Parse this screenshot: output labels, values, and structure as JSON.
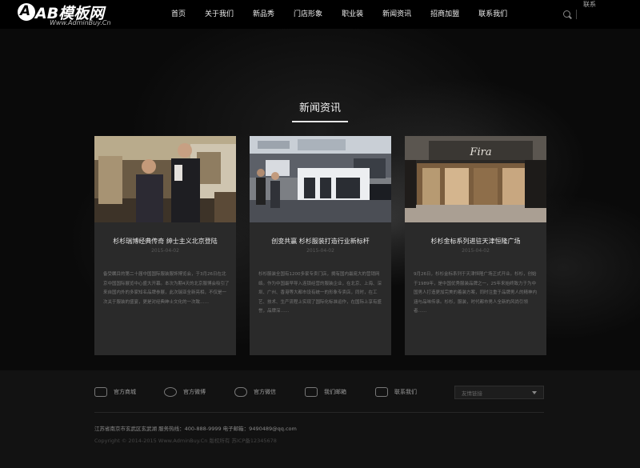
{
  "header": {
    "logo_text": "AB模板网",
    "logo_sub": "Www.AdminBuy.Cn",
    "nav": [
      "首页",
      "关于我们",
      "新品秀",
      "门店形象",
      "职业装",
      "新闻资讯",
      "招商加盟",
      "联系我们"
    ],
    "lang": "联系"
  },
  "section": {
    "title": "新闻资讯"
  },
  "cards": [
    {
      "title": "杉杉瑞博经典传奇 绅士主义北京登陆",
      "date": "2015-04-02",
      "body": "备受瞩目的第二十届中国国际服装服饰博览会，于3月26日在北京中国国际展览中心盛大开幕。本次为期4天的北京服博会吸引了来自国内外的多家知名品牌参展，此次瑞亚全新亮相，不仅是一次关于服装的盛宴，更是对经典绅士文化的一次致……"
    },
    {
      "title": "创变共赢 杉杉服装打造行业新标杆",
      "date": "2015-04-02",
      "body": "杉杉服装全国有1200多家专卖门店，拥有国内最庞大的营销网络。作为中国最早导入连锁经营的服装企业，在北京、上海、深圳、广州、香港等大都市设有统一的形象专卖店，同时，在工艺、技术、生产流程上实现了国际化标准运作，在国际上享有盛誉，品牌深……"
    },
    {
      "title": "杉杉金标系列进驻天津恒隆广场",
      "date": "2015-04-02",
      "body": "9月26日，杉杉金标系列于天津恒隆广场正式开业。杉杉，创始于1989年，是中国优秀服装品牌之一，25年来始终致力于为中国男人打造更加完美的着装方案，同时注重于品牌男人的精神内涵与品味传承。杉杉，服装，时代都市男人全新的风尚引领者……"
    }
  ],
  "footer": {
    "links": [
      "官方商城",
      "官方微博",
      "官方微信",
      "我们邮箱",
      "联系我们"
    ],
    "link_icons": [
      "mall-icon",
      "weibo-icon",
      "wechat-icon",
      "mail-icon",
      "contact-icon"
    ],
    "select_value": "友情链接",
    "info": "江苏省南京市玄武区玄武湖   服务热线：400-888-9999   电子邮箱：9490489@qq.com",
    "copyright": "Copyright © 2014-2015 Www.AdminBuy.Cn 版权所有   苏ICP备12345678"
  }
}
